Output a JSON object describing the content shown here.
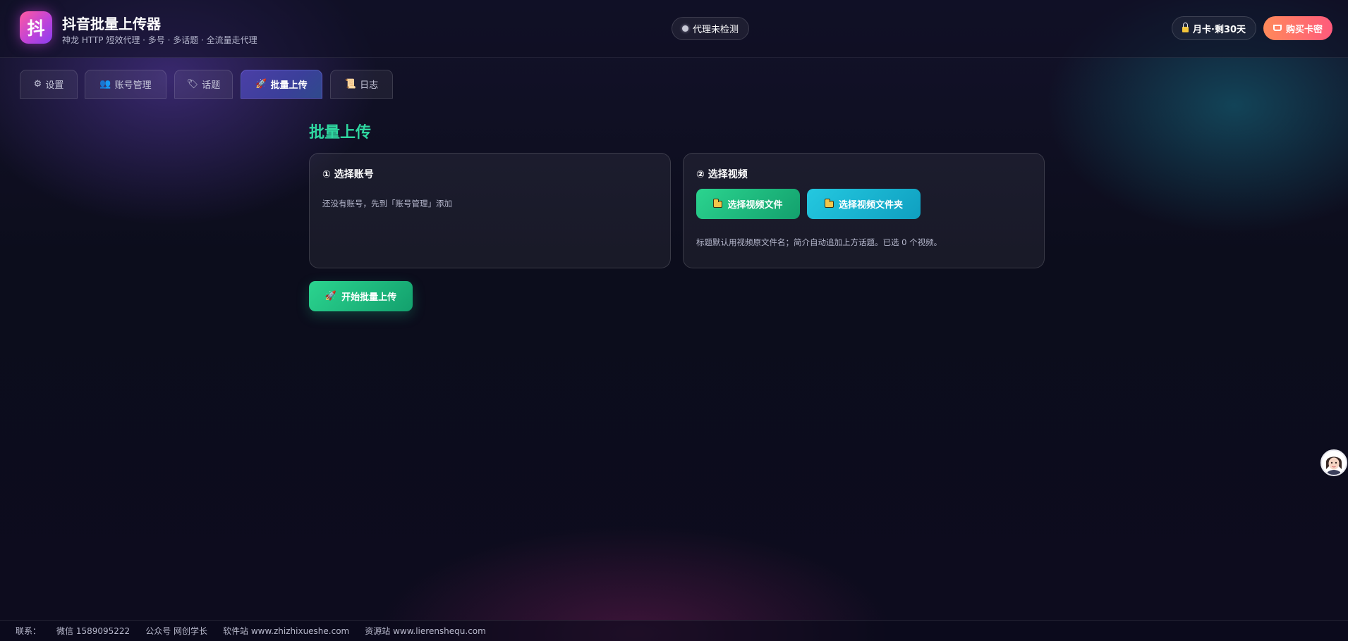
{
  "app": {
    "logo_char": "抖",
    "title": "抖音批量上传器",
    "subtitle": "神龙 HTTP 短效代理 · 多号 · 多话题 · 全流量走代理"
  },
  "header": {
    "proxy_status": "代理未检测",
    "license_label": "月卡·剩30天",
    "buy_label": "购买卡密"
  },
  "tabs": [
    {
      "icon": "⚙",
      "label": "设置",
      "active": false
    },
    {
      "icon": "👥",
      "label": "账号管理",
      "active": false
    },
    {
      "icon": "🏷",
      "label": "话题",
      "active": false
    },
    {
      "icon": "🚀",
      "label": "批量上传",
      "active": true
    },
    {
      "icon": "📜",
      "label": "日志",
      "active": false
    }
  ],
  "main": {
    "title": "批量上传",
    "account_card": {
      "title": "① 选择账号",
      "empty_text": "还没有账号，先到「账号管理」添加"
    },
    "video_card": {
      "title": "② 选择视频",
      "select_files_label": "选择视频文件",
      "select_folder_label": "选择视频文件夹",
      "hint": "标题默认用视频原文件名；简介自动追加上方话题。已选 0 个视频。"
    },
    "start_label": "开始批量上传"
  },
  "footer": {
    "contact_label": "联系：",
    "wechat": "微信 1589095222",
    "official": "公众号 网创学长",
    "software_site": "软件站 www.zhizhixueshe.com",
    "resource_site": "资源站 www.lierenshequ.com"
  },
  "colors": {
    "accent_green": "#2fd7a0",
    "buy_gradient_start": "#ff8a5a",
    "buy_gradient_end": "#ff5a7c",
    "active_tab": "#4b3fa6"
  }
}
